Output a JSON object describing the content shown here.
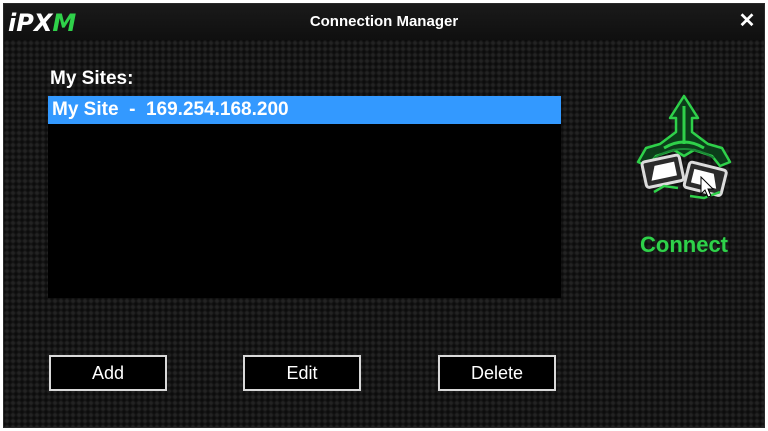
{
  "app": {
    "logo_main": "iPX",
    "logo_accent": "M",
    "title": "Connection Manager",
    "close_glyph": "✕"
  },
  "sites": {
    "label": "My Sites:",
    "items": [
      {
        "label": "My Site  -  169.254.168.200",
        "selected": true
      }
    ]
  },
  "buttons": {
    "add": "Add",
    "edit": "Edit",
    "delete": "Delete"
  },
  "connect": {
    "label": "Connect",
    "icon": "network-connect-icon"
  },
  "colors": {
    "accent_green": "#2fd14a",
    "selection_blue": "#3399ff",
    "background": "#151515"
  }
}
